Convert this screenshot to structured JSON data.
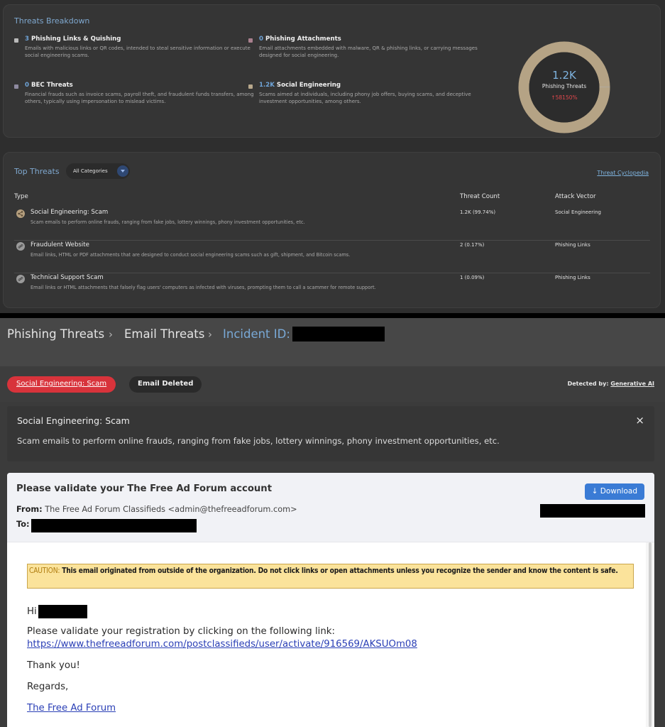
{
  "breakdown": {
    "title": "Threats Breakdown",
    "items": [
      {
        "count": "3",
        "label": "Phishing Links & Quishing",
        "desc": "Emails with malicious links or QR codes, intended to steal sensitive information or execute social engineering scams.",
        "color": "#b9b9b9"
      },
      {
        "count": "0",
        "label": "Phishing Attachments",
        "desc": "Email attachments embedded with malware, QR & phishing links, or carrying messages designed for social engineering.",
        "color": "#a9808e"
      },
      {
        "count": "0",
        "label": "BEC Threats",
        "desc": "Financial frauds such as invoice scams, payroll theft, and fraudulent funds transfers, among others, typically using impersonation to mislead victims.",
        "color": "#8e8aa0"
      },
      {
        "count": "1.2K",
        "label": "Social Engineering",
        "desc": "Scams aimed at individuals, including phony job offers, buying scams, and deceptive investment opportunities, among others.",
        "color": "#b8a88c"
      }
    ],
    "donut": {
      "value": "1.2K",
      "label": "Phishing Threats",
      "change": "↑58150%",
      "ring_color": "#b5a385",
      "segments": [
        {
          "name": "Social Engineering",
          "value": 1200,
          "color": "#b5a385"
        },
        {
          "name": "Phishing Links & Quishing",
          "value": 3,
          "color": "#b9b9b9"
        }
      ]
    }
  },
  "top_threats": {
    "title": "Top Threats",
    "filter": "All Categories",
    "cyclopedia_link": "Threat Cyclopedia",
    "columns": {
      "type": "Type",
      "count": "Threat Count",
      "vector": "Attack Vector"
    },
    "rows": [
      {
        "icon": "share-icon",
        "name": "Social Engineering: Scam",
        "desc": "Scam emails to perform online frauds, ranging from fake jobs, lottery winnings, phony investment opportunities, etc.",
        "count": "1.2K (99.74%)",
        "vector": "Social Engineering"
      },
      {
        "icon": "link-icon",
        "name": "Fraudulent Website",
        "desc": "Email links, HTML or PDF attachments that are designed to conduct social engineering scams such as gift, shipment, and Bitcoin scams.",
        "count": "2 (0.17%)",
        "vector": "Phishing Links"
      },
      {
        "icon": "link-icon",
        "name": "Technical Support Scam",
        "desc": "Email links or HTML attachments that falsely flag users' computers as infected with viruses, prompting them to call a scammer for remote support.",
        "count": "1 (0.09%)",
        "vector": "Phishing Links"
      }
    ]
  },
  "incident": {
    "breadcrumb": [
      "Phishing Threats",
      "Email Threats",
      "Incident ID:"
    ],
    "breadcrumb_separator": "›",
    "badge_category": "Social Engineering: Scam",
    "badge_status": "Email Deleted",
    "detected_by_label": "Detected by:",
    "detected_by_value": "Generative AI",
    "alert_title": "Social Engineering: Scam",
    "alert_desc": "Scam emails to perform online frauds, ranging from fake jobs, lottery winnings, phony investment opportunities, etc.",
    "alert_close": "×"
  },
  "email": {
    "subject": "Please validate your The Free Ad Forum account",
    "from_label": "From:",
    "from_value": "The Free Ad Forum Classifieds <admin@thefreeadforum.com>",
    "to_label": "To:",
    "download_label": "Download",
    "caution_label": "CAUTION:",
    "caution_text": "This email originated from outside of the organization. Do not click links or open attachments unless you recognize the sender and know the content is safe.",
    "greeting": "Hi",
    "line1": "Please validate your registration by clicking on the following link:",
    "link": "https://www.thefreeadforum.com/postclassifieds/user/activate/916569/AKSUOm08",
    "thanks": "Thank you!",
    "regards": "Regards,",
    "signature": "The Free Ad Forum"
  }
}
